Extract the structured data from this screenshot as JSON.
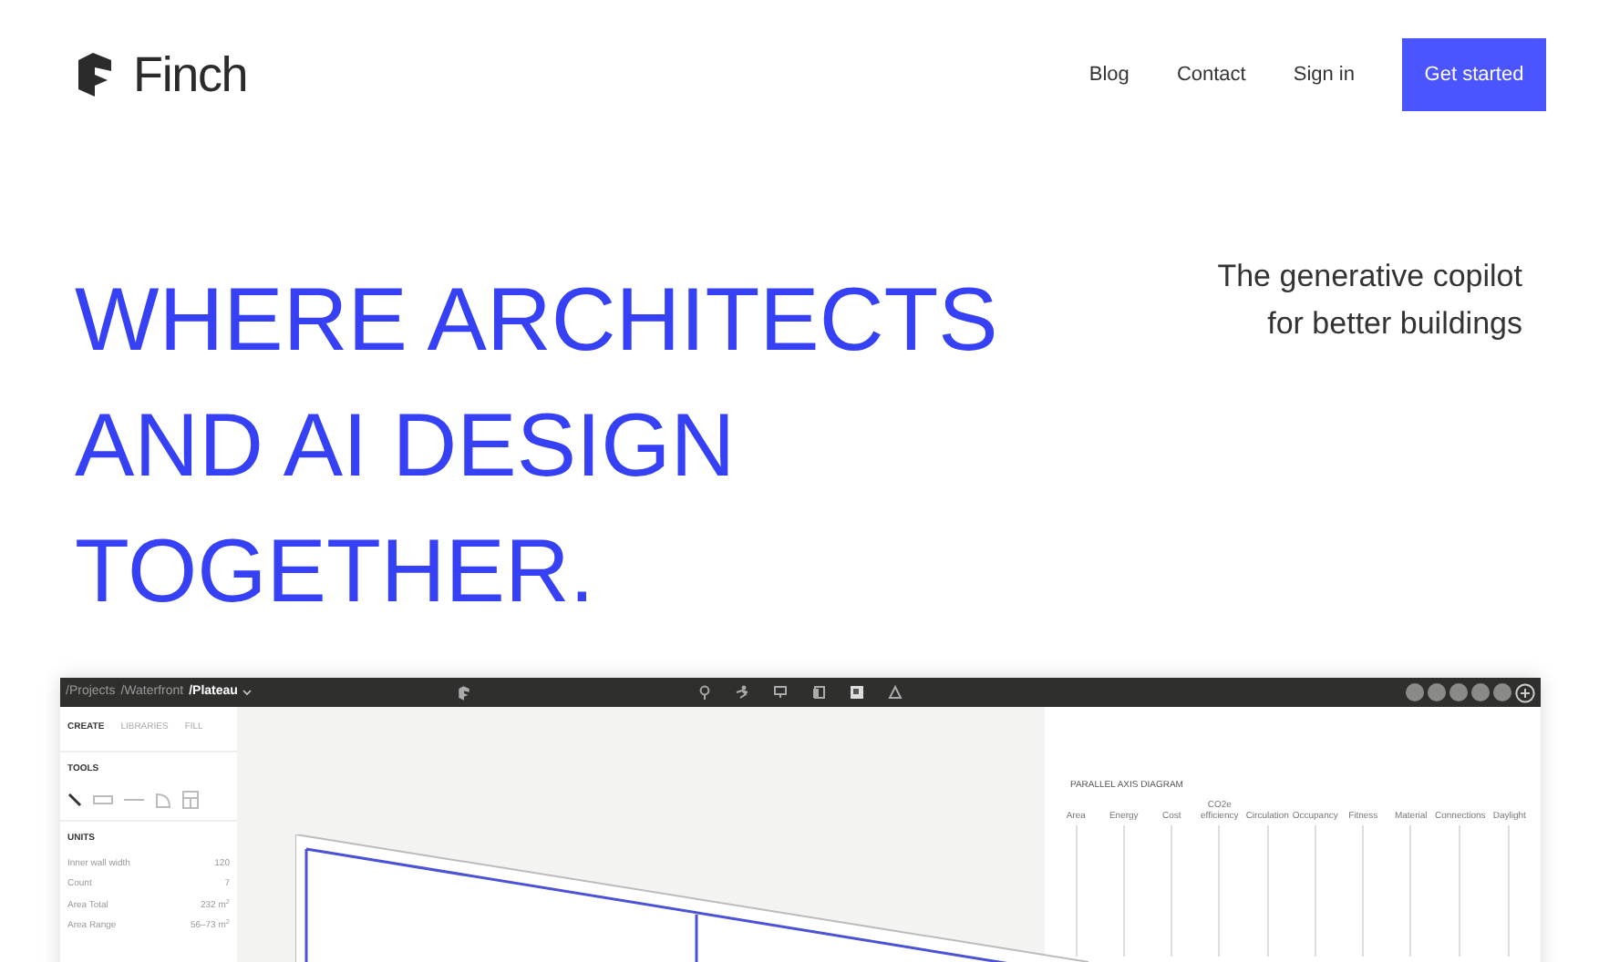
{
  "header": {
    "brand": "Finch",
    "nav": [
      {
        "label": "Blog"
      },
      {
        "label": "Contact"
      },
      {
        "label": "Sign in"
      }
    ],
    "cta": "Get started"
  },
  "hero": {
    "headline_lines": [
      "WHERE ARCHITECTS",
      "AND AI DESIGN",
      "TOGETHER."
    ],
    "tagline_lines": [
      "The generative copilot",
      "for better buildings"
    ]
  },
  "app": {
    "breadcrumb": [
      "/Projects",
      "/Waterfront"
    ],
    "current": "/Plateau",
    "tabs": [
      {
        "label": "CREATE",
        "selected": true
      },
      {
        "label": "LIBRARIES",
        "selected": false
      },
      {
        "label": "FILL",
        "selected": false
      }
    ],
    "tools_title": "TOOLS",
    "units_title": "UNITS",
    "units": [
      {
        "label": "Inner wall width",
        "value": "120"
      },
      {
        "label": "Count",
        "value": "7"
      },
      {
        "label": "Area Total",
        "value": "232 m$^{2}$"
      },
      {
        "label": "Area Range",
        "value": "56–73 m$^{2}$"
      }
    ],
    "diagram": {
      "title": "PARALLEL AXIS DIAGRAM",
      "axes": [
        "Area",
        "Energy",
        "Cost",
        "CO2e efficiency",
        "Circulation",
        "Occupancy",
        "Fitness",
        "Material",
        "Connections",
        "Daylight"
      ]
    }
  }
}
